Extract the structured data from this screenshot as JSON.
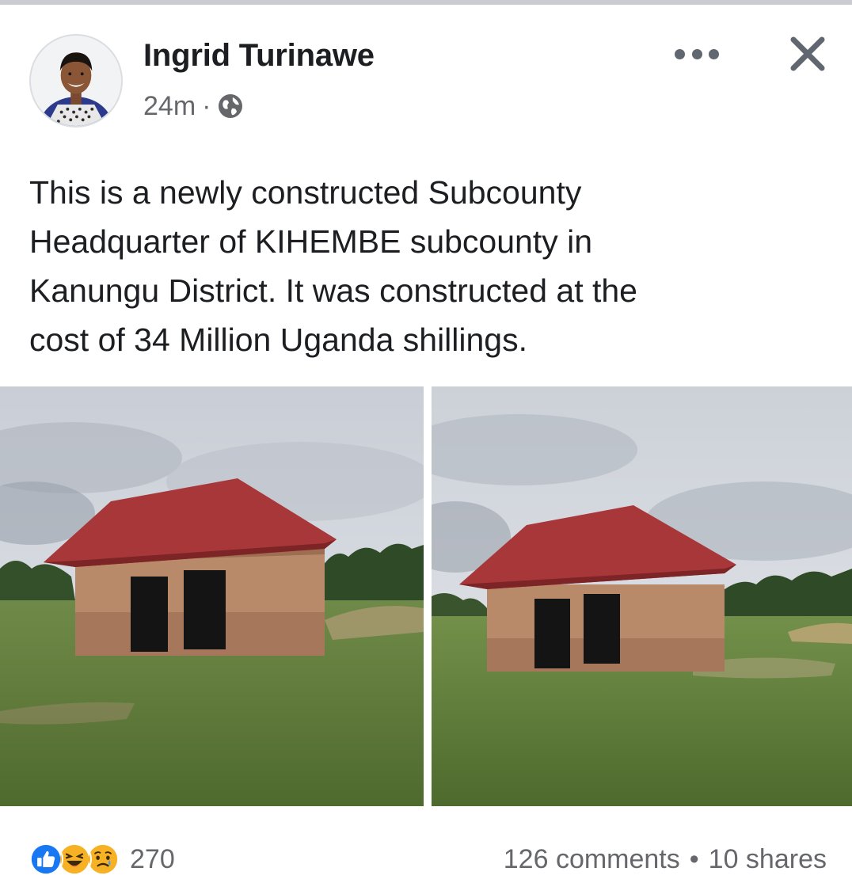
{
  "post": {
    "author": "Ingrid Turinawe",
    "time": "24m",
    "separator": "·",
    "text": "This is a newly constructed Subcounty\nHeadquarter of KIHEMBE subcounty in\nKanungu District. It was constructed at the\ncost of 34 Million Uganda shillings.",
    "audience_icon": "globe-icon",
    "photos": [
      {
        "description_icon": "photo"
      },
      {
        "description_icon": "photo"
      }
    ]
  },
  "footer": {
    "reaction_icons": [
      "like-icon",
      "haha-icon",
      "sad-icon"
    ],
    "reaction_count": "270",
    "comments": "126 comments",
    "dot": "•",
    "shares": "10 shares"
  },
  "colors": {
    "accent": "#1877f2",
    "muted_text": "#65676b",
    "primary_text": "#1c1e21",
    "roof": "#a8373a"
  }
}
